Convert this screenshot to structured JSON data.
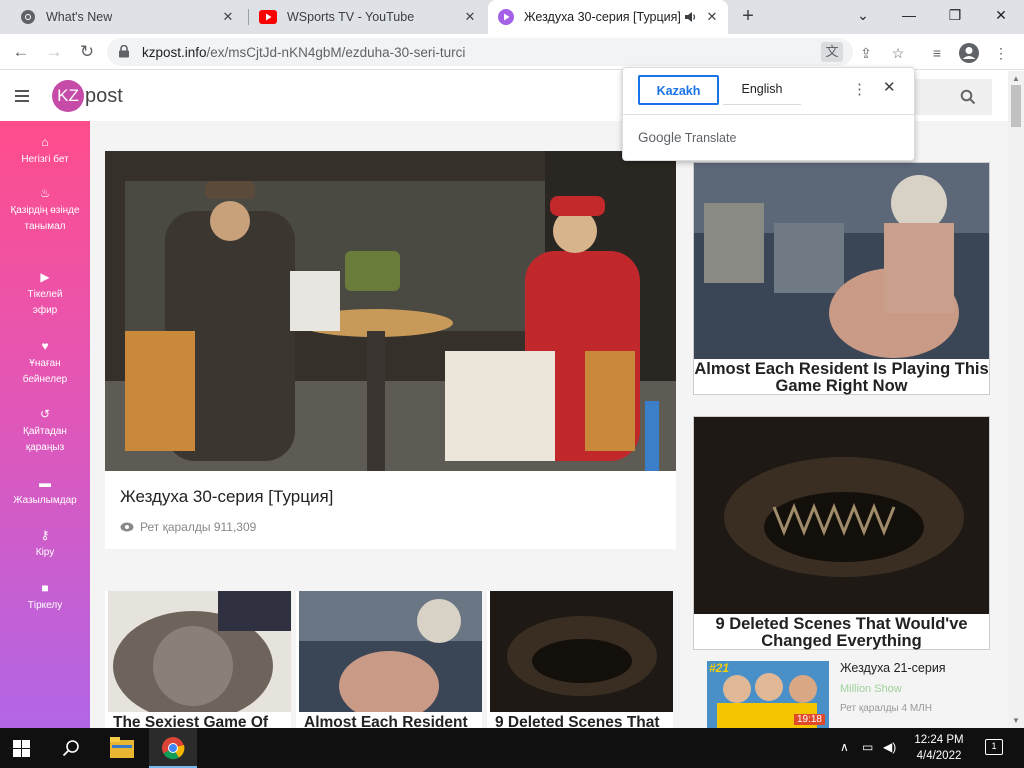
{
  "browser": {
    "tabs": [
      {
        "title": "What's New",
        "icon": "chrome-icon"
      },
      {
        "title": "WSports TV - YouTube",
        "icon": "youtube-icon"
      },
      {
        "title": "Жездуха 30-серия [Турция]",
        "icon": "video-play-icon",
        "active": true
      }
    ],
    "url_domain": "kzpost.info",
    "url_path": "/ex/msCjtJd-nKN4gbM/ezduha-30-seri-turci"
  },
  "translate_popup": {
    "selected_language": "Kazakh",
    "other_language": "English",
    "brand_google": "Google",
    "brand_translate": "Translate"
  },
  "site": {
    "logo_kz": "KZ",
    "logo_post": "post",
    "sidebar": [
      {
        "label": "Негізгі бет",
        "icon": "home-icon"
      },
      {
        "label": "Қазірдің өзінде танымал",
        "icon": "flame-icon"
      },
      {
        "label": "Тікелей эфир",
        "icon": "live-icon"
      },
      {
        "label": "Ұнаған бейнелер",
        "icon": "heart-icon"
      },
      {
        "label": "Қайтадан қараңыз",
        "icon": "history-icon"
      },
      {
        "label": "Жазылымдар",
        "icon": "folder-icon"
      },
      {
        "label": "Кіру",
        "icon": "key-icon"
      },
      {
        "label": "Тіркелу",
        "icon": "lock-icon"
      }
    ]
  },
  "main_video": {
    "title": "Жездуха 30-серия [Турция]",
    "views_label": "Рет қаралды 911,309"
  },
  "ads_right": [
    {
      "caption": "Almost Each Resident Is Playing This Game Right Now"
    },
    {
      "caption": "9 Deleted Scenes That Would've Changed Everything"
    }
  ],
  "ads_bottom": [
    {
      "caption": "The Sexiest Game Of"
    },
    {
      "caption": "Almost Each Resident"
    },
    {
      "caption": "9 Deleted Scenes That"
    }
  ],
  "related": {
    "title": "Жездуха 21-серия",
    "channel": "Million Show",
    "views": "Рет қаралды 4 МЛН",
    "rank_badge": "#21",
    "duration": "19:18"
  },
  "taskbar": {
    "time": "12:24 PM",
    "date": "4/4/2022",
    "notifications": "1"
  }
}
